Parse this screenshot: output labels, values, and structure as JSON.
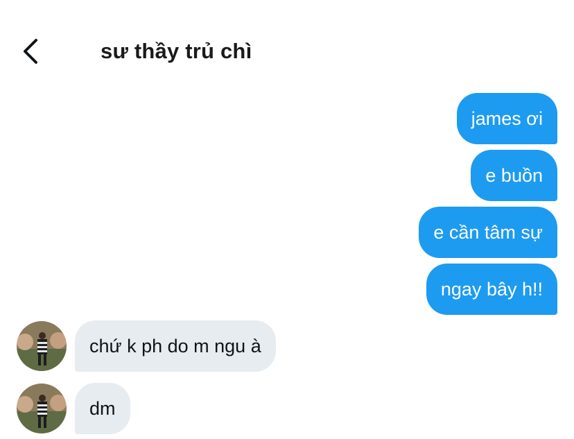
{
  "header": {
    "title": "sư thầy trủ chì",
    "back_icon": "chevron-left-icon"
  },
  "colors": {
    "sent_bubble": "#1d9bf0",
    "received_bubble": "#e6ecf0"
  },
  "messages": [
    {
      "direction": "sent",
      "text": "james ơi"
    },
    {
      "direction": "sent",
      "text": "e buồn"
    },
    {
      "direction": "sent",
      "text": "e cần tâm sự"
    },
    {
      "direction": "sent",
      "text": "ngay bây h!!"
    },
    {
      "direction": "received",
      "text": "chứ k ph do m ngu à",
      "avatar": "user-avatar"
    },
    {
      "direction": "received",
      "text": "dm",
      "avatar": "user-avatar"
    }
  ]
}
